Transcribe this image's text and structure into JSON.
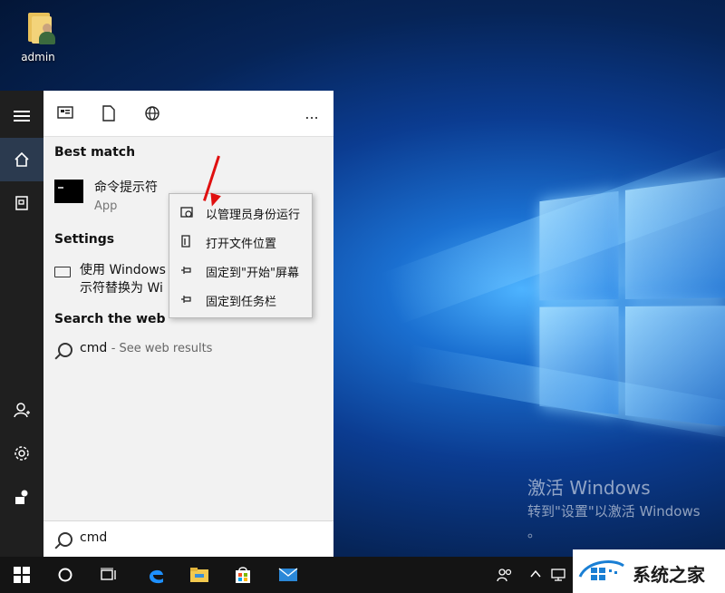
{
  "desktop": {
    "icon_label": "admin",
    "watermark": {
      "title": "激活 Windows",
      "line1": "转到\"设置\"以激活 Windows",
      "line2": "。"
    }
  },
  "start": {
    "best_match_label": "Best match",
    "best_match": {
      "title": "命令提示符",
      "subtitle": "App"
    },
    "settings_label": "Settings",
    "settings_item_line1": "使用 Windows",
    "settings_item_line2": "示符替换为 Wi",
    "search_web_label": "Search the web",
    "web_result": {
      "query": "cmd",
      "suffix": "- See web results"
    },
    "search_box_value": "cmd",
    "more_label": "..."
  },
  "context_menu": [
    {
      "label": "以管理员身份运行",
      "icon": "shield-run-icon"
    },
    {
      "label": "打开文件位置",
      "icon": "open-file-location-icon"
    },
    {
      "label": "固定到\"开始\"屏幕",
      "icon": "pin-icon"
    },
    {
      "label": "固定到任务栏",
      "icon": "pin-icon"
    }
  ],
  "brand": {
    "text": "系统之家"
  },
  "colors": {
    "rail": "#1f1f1f",
    "panel": "#f2f2f2",
    "taskbar": "#141414",
    "arrow": "#e01010",
    "edge": "#1e90ff"
  }
}
